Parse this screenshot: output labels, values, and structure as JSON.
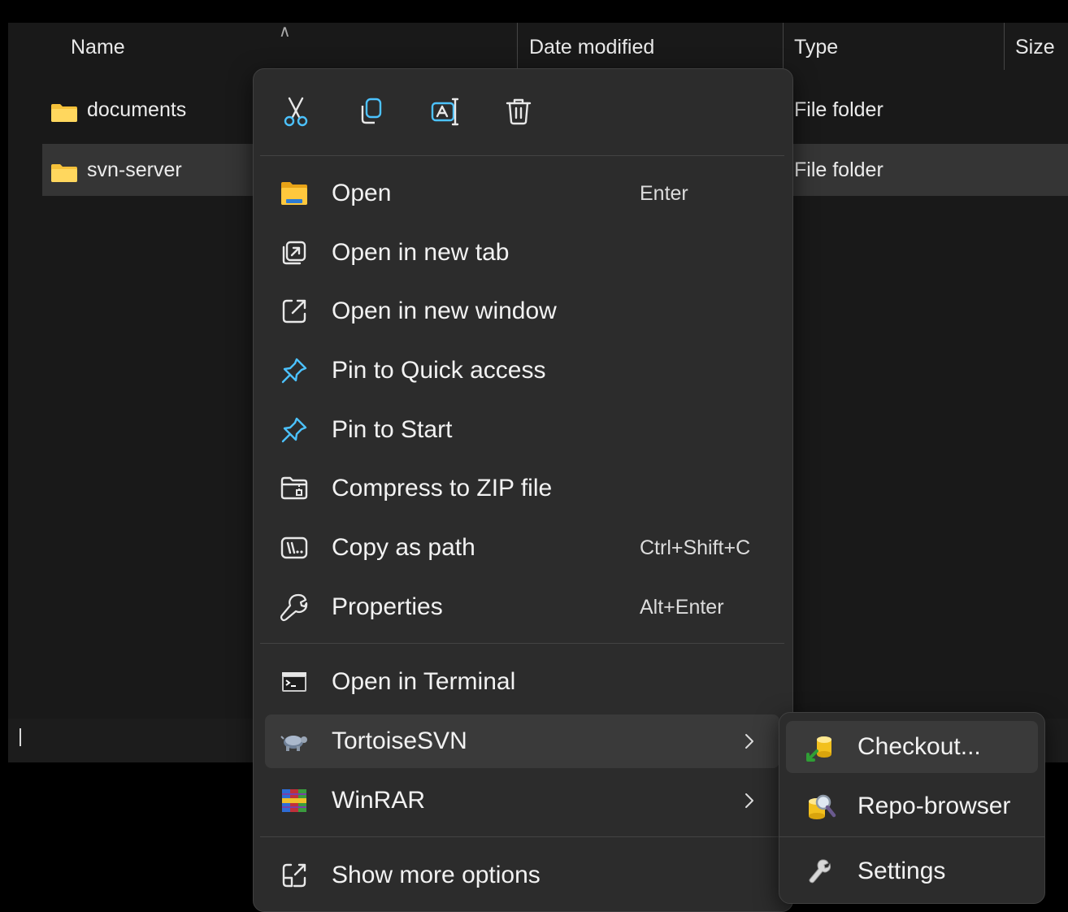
{
  "columns": {
    "name": "Name",
    "date_modified": "Date modified",
    "type": "Type",
    "size": "Size"
  },
  "files": [
    {
      "name": "documents",
      "type": "File folder",
      "icon": "folder-icon"
    },
    {
      "name": "svn-server",
      "type": "File folder",
      "icon": "folder-icon",
      "selected": true
    }
  ],
  "context_menu": {
    "toolbar": [
      "cut-icon",
      "copy-icon",
      "rename-icon",
      "delete-icon"
    ],
    "items": [
      {
        "label": "Open",
        "shortcut": "Enter",
        "icon": "folder-open-icon"
      },
      {
        "label": "Open in new tab",
        "shortcut": "",
        "icon": "new-tab-icon"
      },
      {
        "label": "Open in new window",
        "shortcut": "",
        "icon": "new-window-icon"
      },
      {
        "label": "Pin to Quick access",
        "shortcut": "",
        "icon": "pin-icon"
      },
      {
        "label": "Pin to Start",
        "shortcut": "",
        "icon": "pin-icon"
      },
      {
        "label": "Compress to ZIP file",
        "shortcut": "",
        "icon": "zip-icon"
      },
      {
        "label": "Copy as path",
        "shortcut": "Ctrl+Shift+C",
        "icon": "copy-path-icon"
      },
      {
        "label": "Properties",
        "shortcut": "Alt+Enter",
        "icon": "wrench-icon"
      },
      {
        "label": "Open in Terminal",
        "shortcut": "",
        "icon": "terminal-icon"
      },
      {
        "label": "TortoiseSVN",
        "shortcut": "",
        "icon": "tortoise-icon",
        "submenu": true
      },
      {
        "label": "WinRAR",
        "shortcut": "",
        "icon": "winrar-icon",
        "submenu": true
      },
      {
        "label": "Show more options",
        "shortcut": "",
        "icon": "more-options-icon"
      }
    ]
  },
  "tortoise_submenu": {
    "items": [
      {
        "label": "Checkout...",
        "icon": "svn-checkout-icon"
      },
      {
        "label": "Repo-browser",
        "icon": "svn-repo-browser-icon"
      },
      {
        "label": "Settings",
        "icon": "settings-wrench-icon"
      }
    ]
  },
  "colors": {
    "folder": "#f5c13a",
    "accent_blue": "#4cc2ff",
    "menu_bg": "#2c2c2c"
  }
}
